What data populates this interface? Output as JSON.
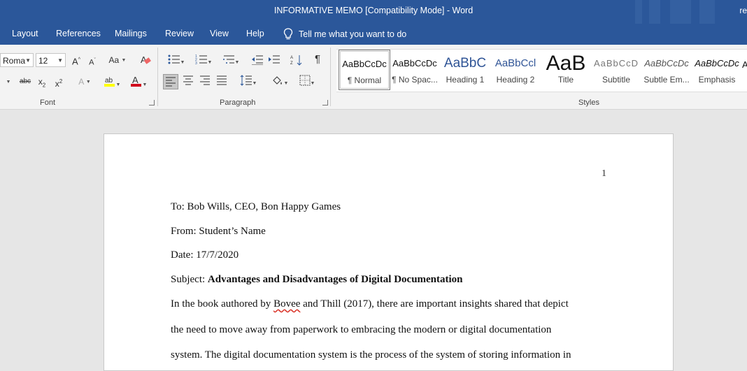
{
  "window": {
    "title": "INFORMATIVE MEMO [Compatibility Mode]  -  Word",
    "right_fragment": "re"
  },
  "menu": {
    "tabs": [
      "Layout",
      "References",
      "Mailings",
      "Review",
      "View",
      "Help"
    ],
    "tell_me": "Tell me what you want to do"
  },
  "ribbon": {
    "font": {
      "name": "Roma",
      "size": "12",
      "group_label": "Font"
    },
    "paragraph": {
      "group_label": "Paragraph"
    },
    "styles": {
      "group_label": "Styles",
      "items": [
        {
          "preview": "AaBbCcDc",
          "name": "¶ Normal"
        },
        {
          "preview": "AaBbCcDc",
          "name": "¶ No Spac..."
        },
        {
          "preview": "AaBbC",
          "name": "Heading 1"
        },
        {
          "preview": "AaBbCcl",
          "name": "Heading 2"
        },
        {
          "preview": "AaB",
          "name": "Title"
        },
        {
          "preview": "AaBbCcD",
          "name": "Subtitle"
        },
        {
          "preview": "AaBbCcDc",
          "name": "Subtle Em..."
        },
        {
          "preview": "AaBbCcDc",
          "name": "Emphasis"
        }
      ]
    },
    "colors": {
      "highlight": "#ffff00",
      "font_color": "#d0021b"
    }
  },
  "document": {
    "page_number": "1",
    "to": "To: Bob Wills, CEO, Bon Happy Games",
    "from": "From: Student’s Name",
    "date": "Date: 17/7/2020",
    "subject_label": "Subject: ",
    "subject_bold": "Advantages and Disadvantages of Digital Documentation",
    "body_line1_pre": "In the book authored by ",
    "body_line1_word": "Bovee",
    "body_line1_post": " and Thill (2017), there are important insights shared that depict",
    "body_line2": "the need to move away from paperwork to embracing the modern or digital documentation",
    "body_line3": "system. The digital documentation system is the process of the system of storing information in"
  }
}
